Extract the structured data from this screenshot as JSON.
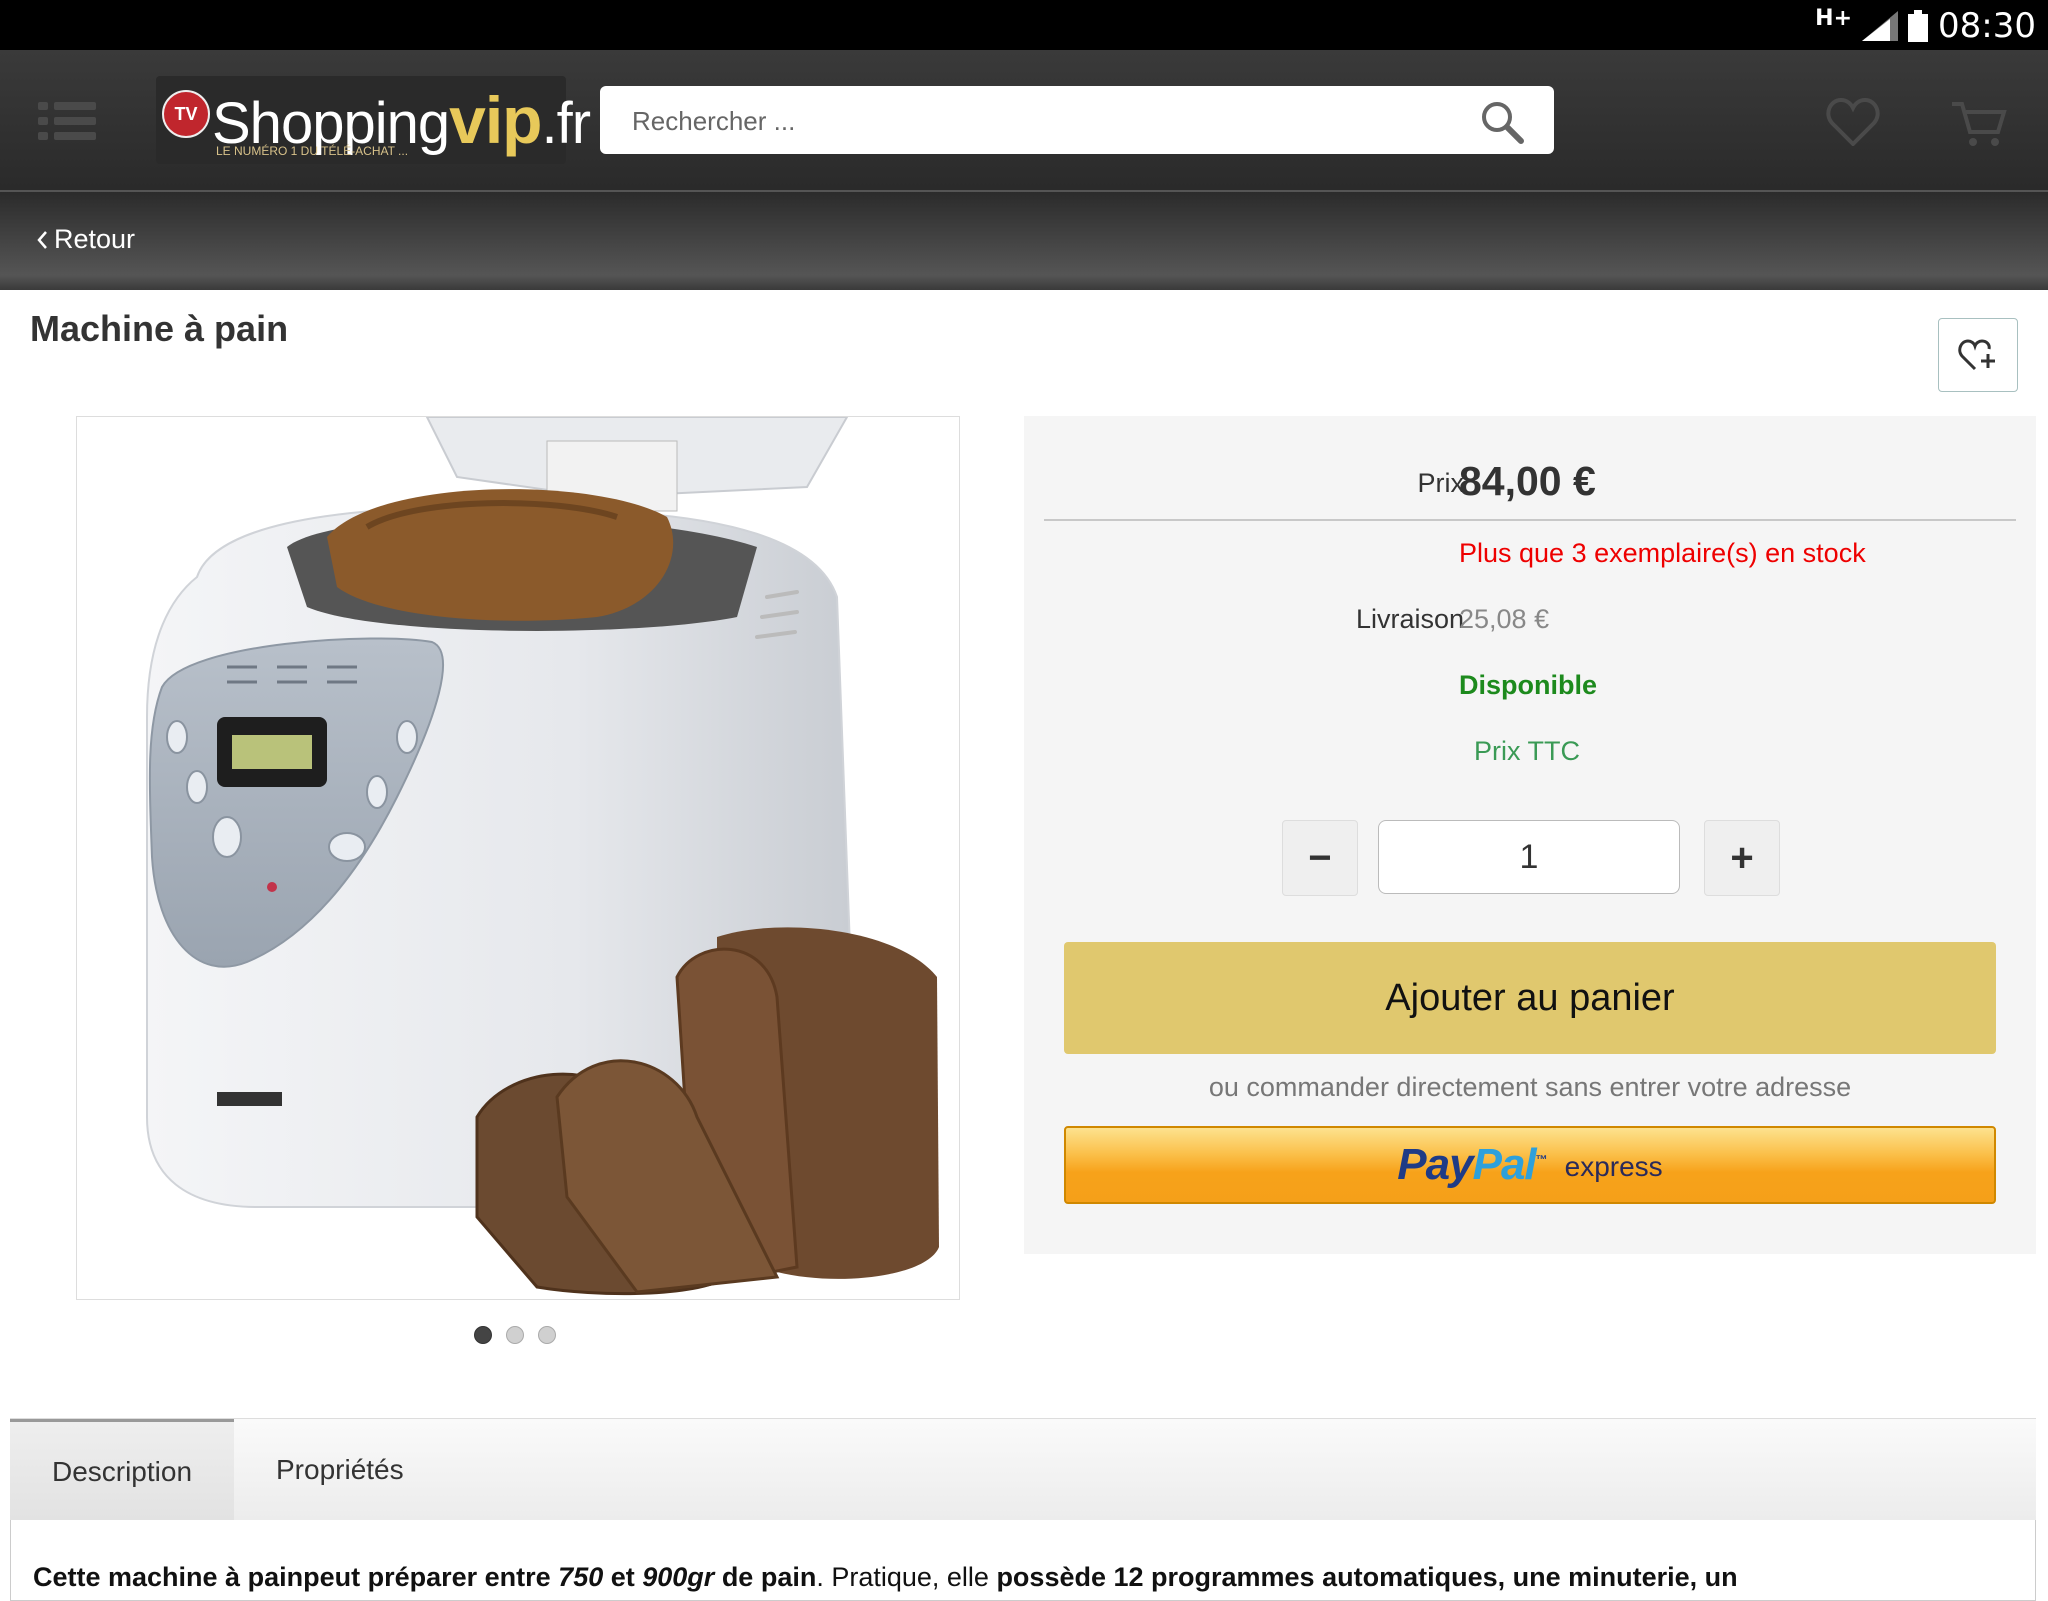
{
  "status_bar": {
    "network": "H+",
    "time": "08:30"
  },
  "header": {
    "logo": {
      "brand": "Shopping",
      "brand_bold": "vip",
      "tld": ".fr",
      "badge": "TV",
      "tagline": "LE NUMÉRO 1 DU TÉLÉ-ACHAT ..."
    },
    "search": {
      "placeholder": "Rechercher ..."
    },
    "icons": [
      "menu-icon",
      "search-icon",
      "heart-icon",
      "cart-icon"
    ]
  },
  "subbar": {
    "back_label": "Retour"
  },
  "product": {
    "title": "Machine à pain",
    "image_dots": {
      "count": 3,
      "active_index": 0
    },
    "price_label": "Prix",
    "price_value": "84,00 €",
    "stock_text": "Plus que 3 exemplaire(s) en stock",
    "shipping_label": "Livraison",
    "shipping_value": "25,08 €",
    "availability": "Disponible",
    "tax_note": "Prix TTC",
    "quantity": "1",
    "qty_minus": "−",
    "qty_plus": "+",
    "add_to_cart": "Ajouter au panier",
    "or_text": "ou commander directement sans entrer votre adresse",
    "paypal": {
      "pay": "Pay",
      "pal": "Pal",
      "tm": "™",
      "express": "express"
    }
  },
  "tabs": [
    {
      "label": "Description",
      "active": true
    },
    {
      "label": "Propriétés",
      "active": false
    }
  ],
  "description": {
    "b1": "Cette machine à pain",
    "b2": "peut préparer entre ",
    "i1": "750",
    "b3": " et ",
    "i2": "900gr",
    "b4": " de pain",
    "n1": ". Pratique, elle ",
    "b5": "possède 12 programmes automatiques, une minuterie, un"
  },
  "colors": {
    "header_bg": "#2f2f2f",
    "add_to_cart_bg": "#e0c86e",
    "stock_red": "#e00000",
    "available_green": "#1d8a1d",
    "ttc_green": "#3a9a55",
    "paypal_orange": "#f7a21a"
  }
}
